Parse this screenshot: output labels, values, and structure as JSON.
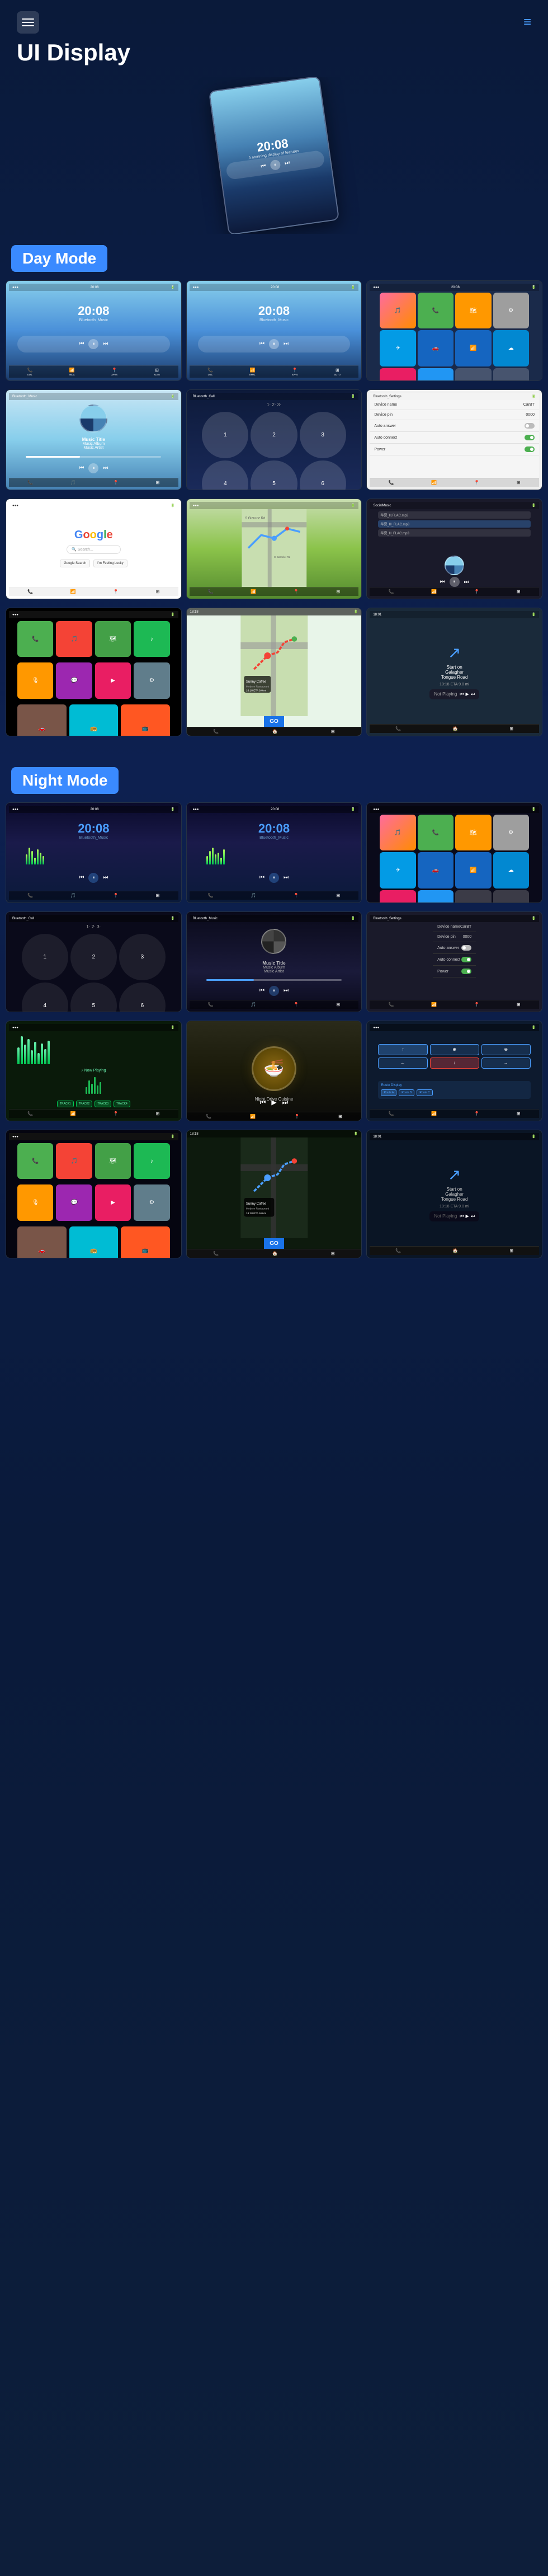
{
  "app": {
    "title": "UI Display",
    "menu_label": "Menu",
    "nav_color": "#4a9eff"
  },
  "hero": {
    "time": "20:08",
    "subtitle": "A stunning display of features"
  },
  "day_mode": {
    "label": "Day Mode",
    "screens": [
      {
        "id": "day-home-1",
        "type": "home",
        "time": "20:08",
        "subtitle": "Bluetooth_Music"
      },
      {
        "id": "day-home-2",
        "type": "home",
        "time": "20:08",
        "subtitle": "Bluetooth_Music"
      },
      {
        "id": "day-apps",
        "type": "apps",
        "label": "Apps Grid"
      }
    ],
    "row2": [
      {
        "id": "day-bt-music",
        "type": "bluetooth_music",
        "title": "Bluetooth_Music"
      },
      {
        "id": "day-bt-call",
        "type": "bluetooth_call",
        "title": "Bluetooth_Call"
      },
      {
        "id": "day-settings",
        "type": "settings",
        "title": "Bluetooth_Settings"
      }
    ],
    "row3": [
      {
        "id": "day-google",
        "type": "google",
        "title": "Google"
      },
      {
        "id": "day-maps",
        "type": "maps",
        "title": "Maps Navigation"
      },
      {
        "id": "day-social",
        "type": "social",
        "title": "SocialMusic"
      }
    ],
    "row4": [
      {
        "id": "day-carplay-1",
        "type": "carplay",
        "title": "CarPlay Home"
      },
      {
        "id": "day-carplay-maps",
        "type": "carplay_maps",
        "title": "Sunny Coffee Modern Restaurant"
      },
      {
        "id": "day-carplay-nav",
        "type": "carplay_nav",
        "title": "Navigation"
      }
    ]
  },
  "night_mode": {
    "label": "Night Mode",
    "screens": [
      {
        "id": "night-home-1",
        "type": "home_night",
        "time": "20:08"
      },
      {
        "id": "night-home-2",
        "type": "home_night",
        "time": "20:08"
      },
      {
        "id": "night-apps",
        "type": "apps_night",
        "label": "Apps Grid Night"
      }
    ],
    "row2": [
      {
        "id": "night-bt-call",
        "type": "bt_call_night",
        "title": "Bluetooth_Call"
      },
      {
        "id": "night-bt-music",
        "type": "bt_music_night",
        "title": "Bluetooth_Music"
      },
      {
        "id": "night-settings",
        "type": "settings_night",
        "title": "Bluetooth_Settings"
      }
    ],
    "row3": [
      {
        "id": "night-wave",
        "type": "waveform_night",
        "title": "Waveform"
      },
      {
        "id": "night-food",
        "type": "food_video",
        "title": "Food Video"
      },
      {
        "id": "night-map-nav",
        "type": "map_nav_night",
        "title": "Navigation Night"
      }
    ],
    "row4": [
      {
        "id": "night-carplay-1",
        "type": "carplay_night",
        "title": "CarPlay Night"
      },
      {
        "id": "night-carplay-maps",
        "type": "carplay_maps_night",
        "title": "Maps Night"
      },
      {
        "id": "night-carplay-nav",
        "type": "carplay_nav_night",
        "title": "Navigation Night"
      }
    ]
  },
  "music_info": {
    "title": "Music Title",
    "album": "Music Album",
    "artist": "Music Artist"
  },
  "settings_items": [
    {
      "label": "Device name",
      "value": "CarBT",
      "has_toggle": false
    },
    {
      "label": "Device pin",
      "value": "0000",
      "has_toggle": false
    },
    {
      "label": "Auto answer",
      "value": "",
      "has_toggle": true,
      "toggle_on": false
    },
    {
      "label": "Auto connect",
      "value": "",
      "has_toggle": true,
      "toggle_on": true
    },
    {
      "label": "Power",
      "value": "",
      "has_toggle": true,
      "toggle_on": true
    }
  ],
  "nav_info": {
    "restaurant": "Sunny Coffee Modern Restaurant",
    "eta": "18:18 ETA",
    "distance": "9.0 mi",
    "road": "Start on Galagher Tongue Road",
    "time_remaining": "10:18 ETA",
    "go_button": "GO"
  },
  "social_music_files": [
    "华夏_lll.FLAC.mp3",
    "华夏_Ill_FLAC.mp3",
    "华夏_lll_FLAC.mp3"
  ]
}
